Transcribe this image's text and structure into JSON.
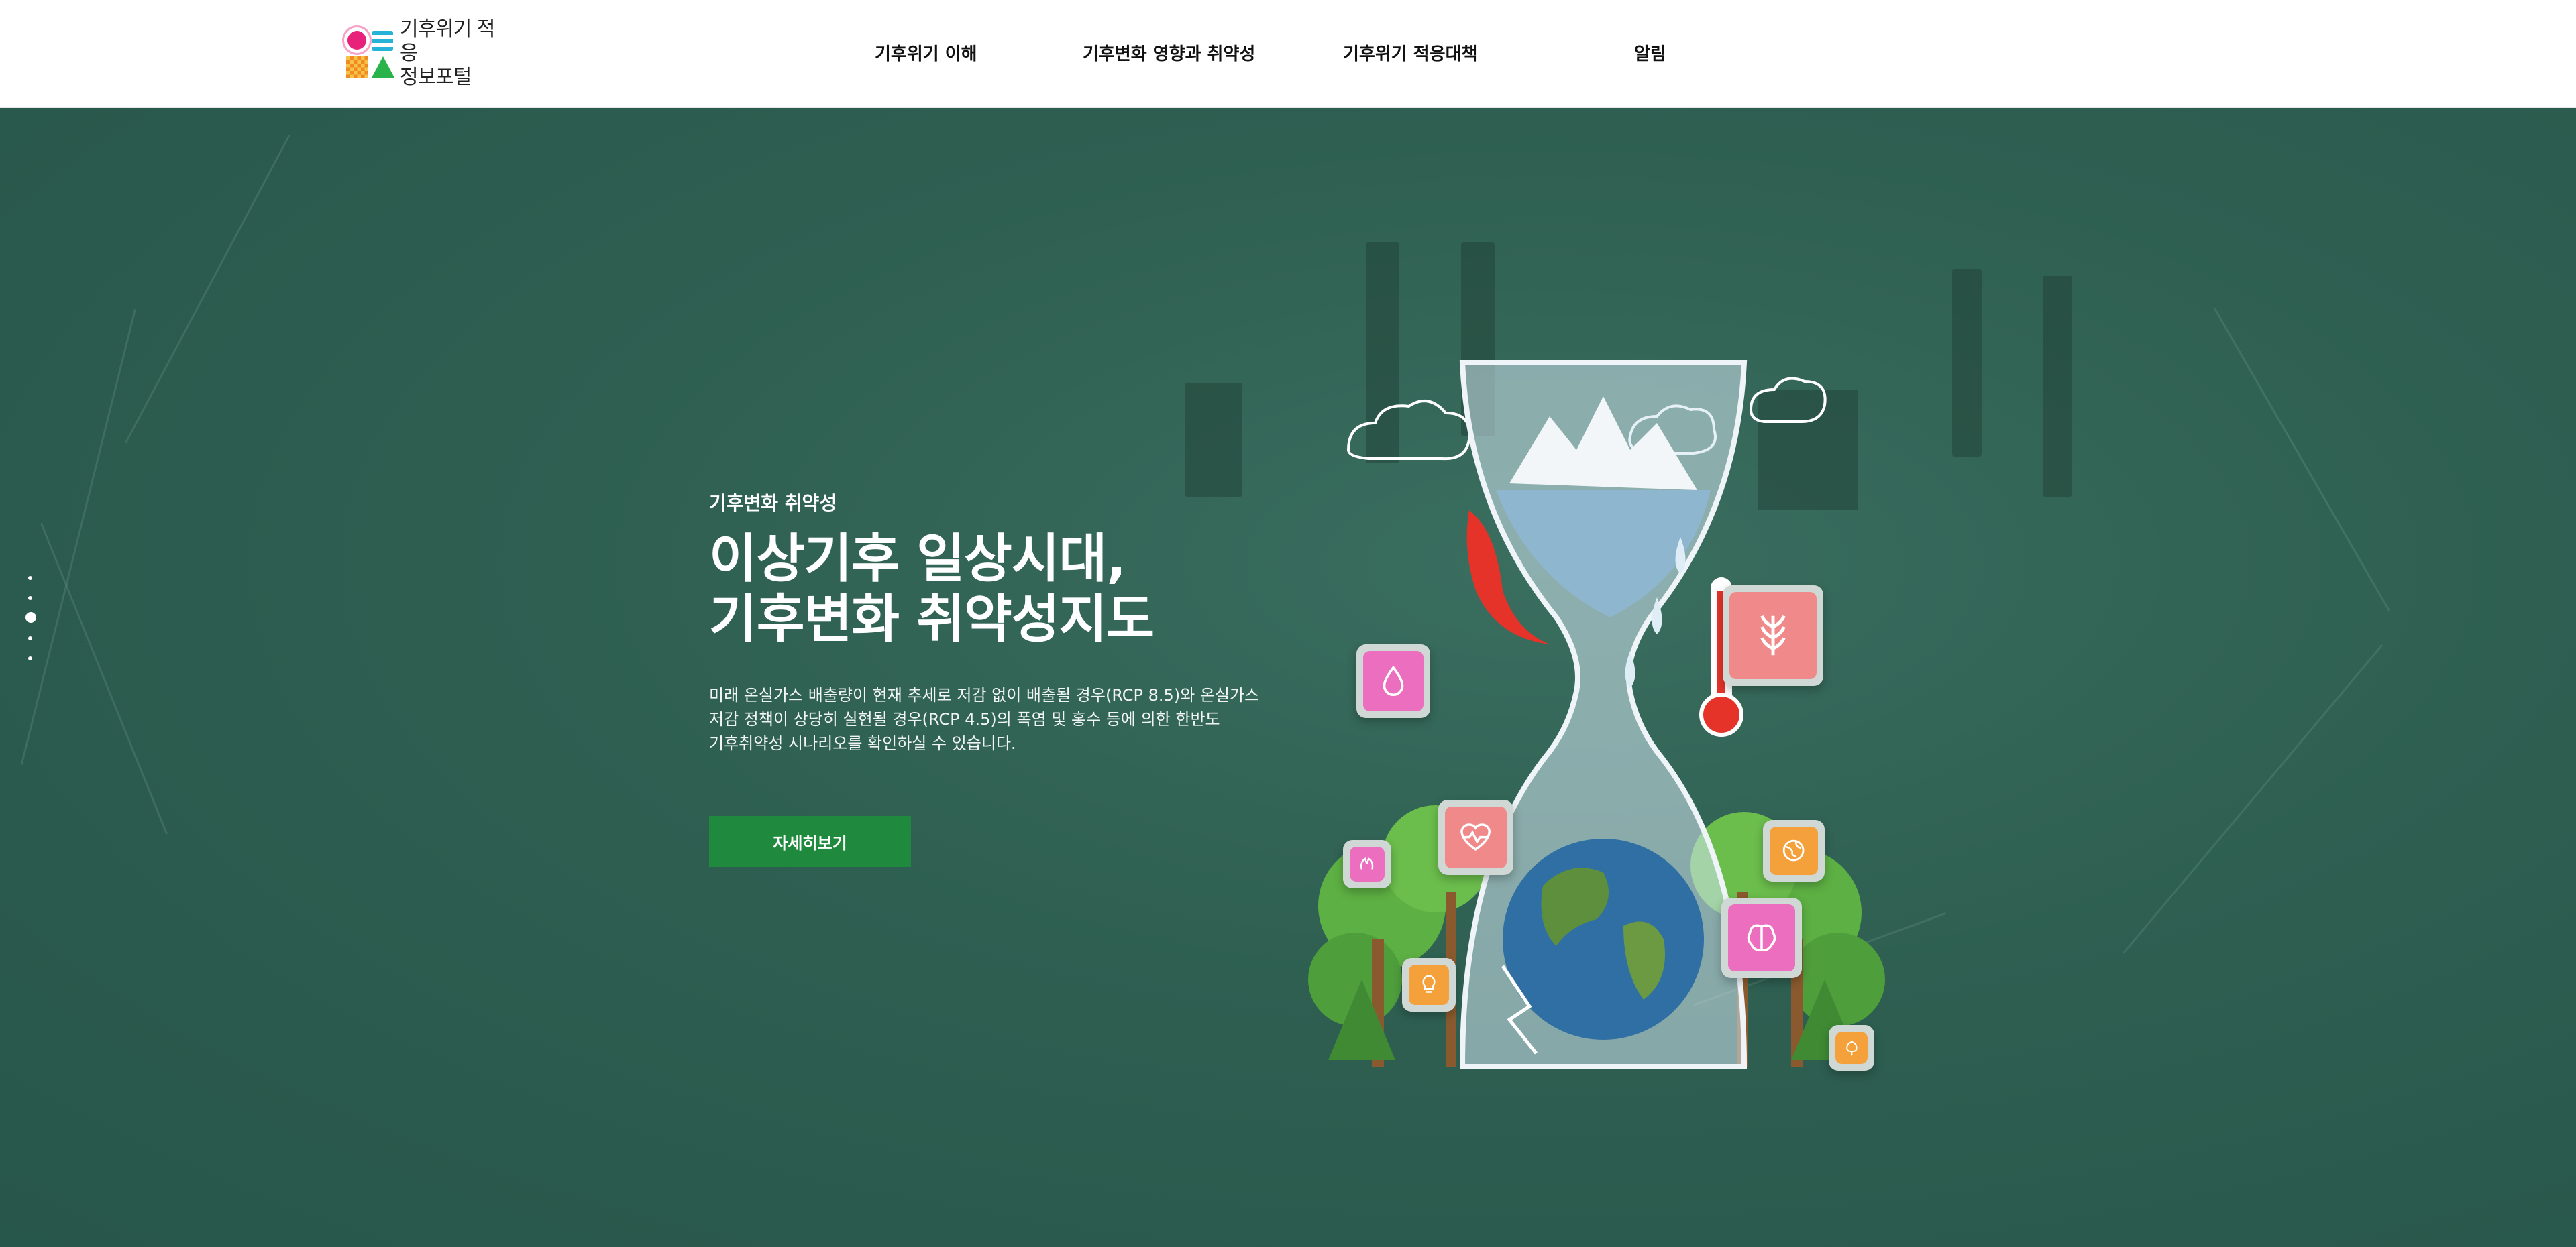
{
  "header": {
    "logo": {
      "line1": "기후위기 적응",
      "line2": "정보포털"
    },
    "nav": [
      {
        "label": "기후위기 이해"
      },
      {
        "label": "기후변화 영향과 취약성"
      },
      {
        "label": "기후위기 적응대책"
      },
      {
        "label": "알림"
      }
    ]
  },
  "hero": {
    "eyebrow": "기후변화 취약성",
    "headline": [
      "이상기후 일상시대,",
      "기후변화 취약성지도"
    ],
    "description": [
      "미래 온실가스 배출량이 현재 추세로 저감 없이 배출될 경우(RCP 8.5)와 온실가스",
      "저감 정책이 상당히 실현될 경우(RCP 4.5)의 폭염 및 홍수 등에 의한 한반도",
      "기후취약성 시나리오를 확인하실 수 있습니다."
    ],
    "cta_label": "자세히보기",
    "pagination": {
      "total": 5,
      "active": 3
    }
  },
  "colors": {
    "hero_background": "#2e5f51",
    "cta_background": "#1f8a3e",
    "logo_pink": "#e8217a",
    "logo_blue": "#27b3d8",
    "logo_orange": "#f28a22",
    "logo_green": "#29b34a"
  },
  "illustration": {
    "icons": [
      "water-drop-icon",
      "wheat-icon",
      "heartbeat-icon",
      "thermometer-icon",
      "globe-icon",
      "brain-icon",
      "lung-icon",
      "bulb-icon",
      "tree-icon"
    ]
  }
}
